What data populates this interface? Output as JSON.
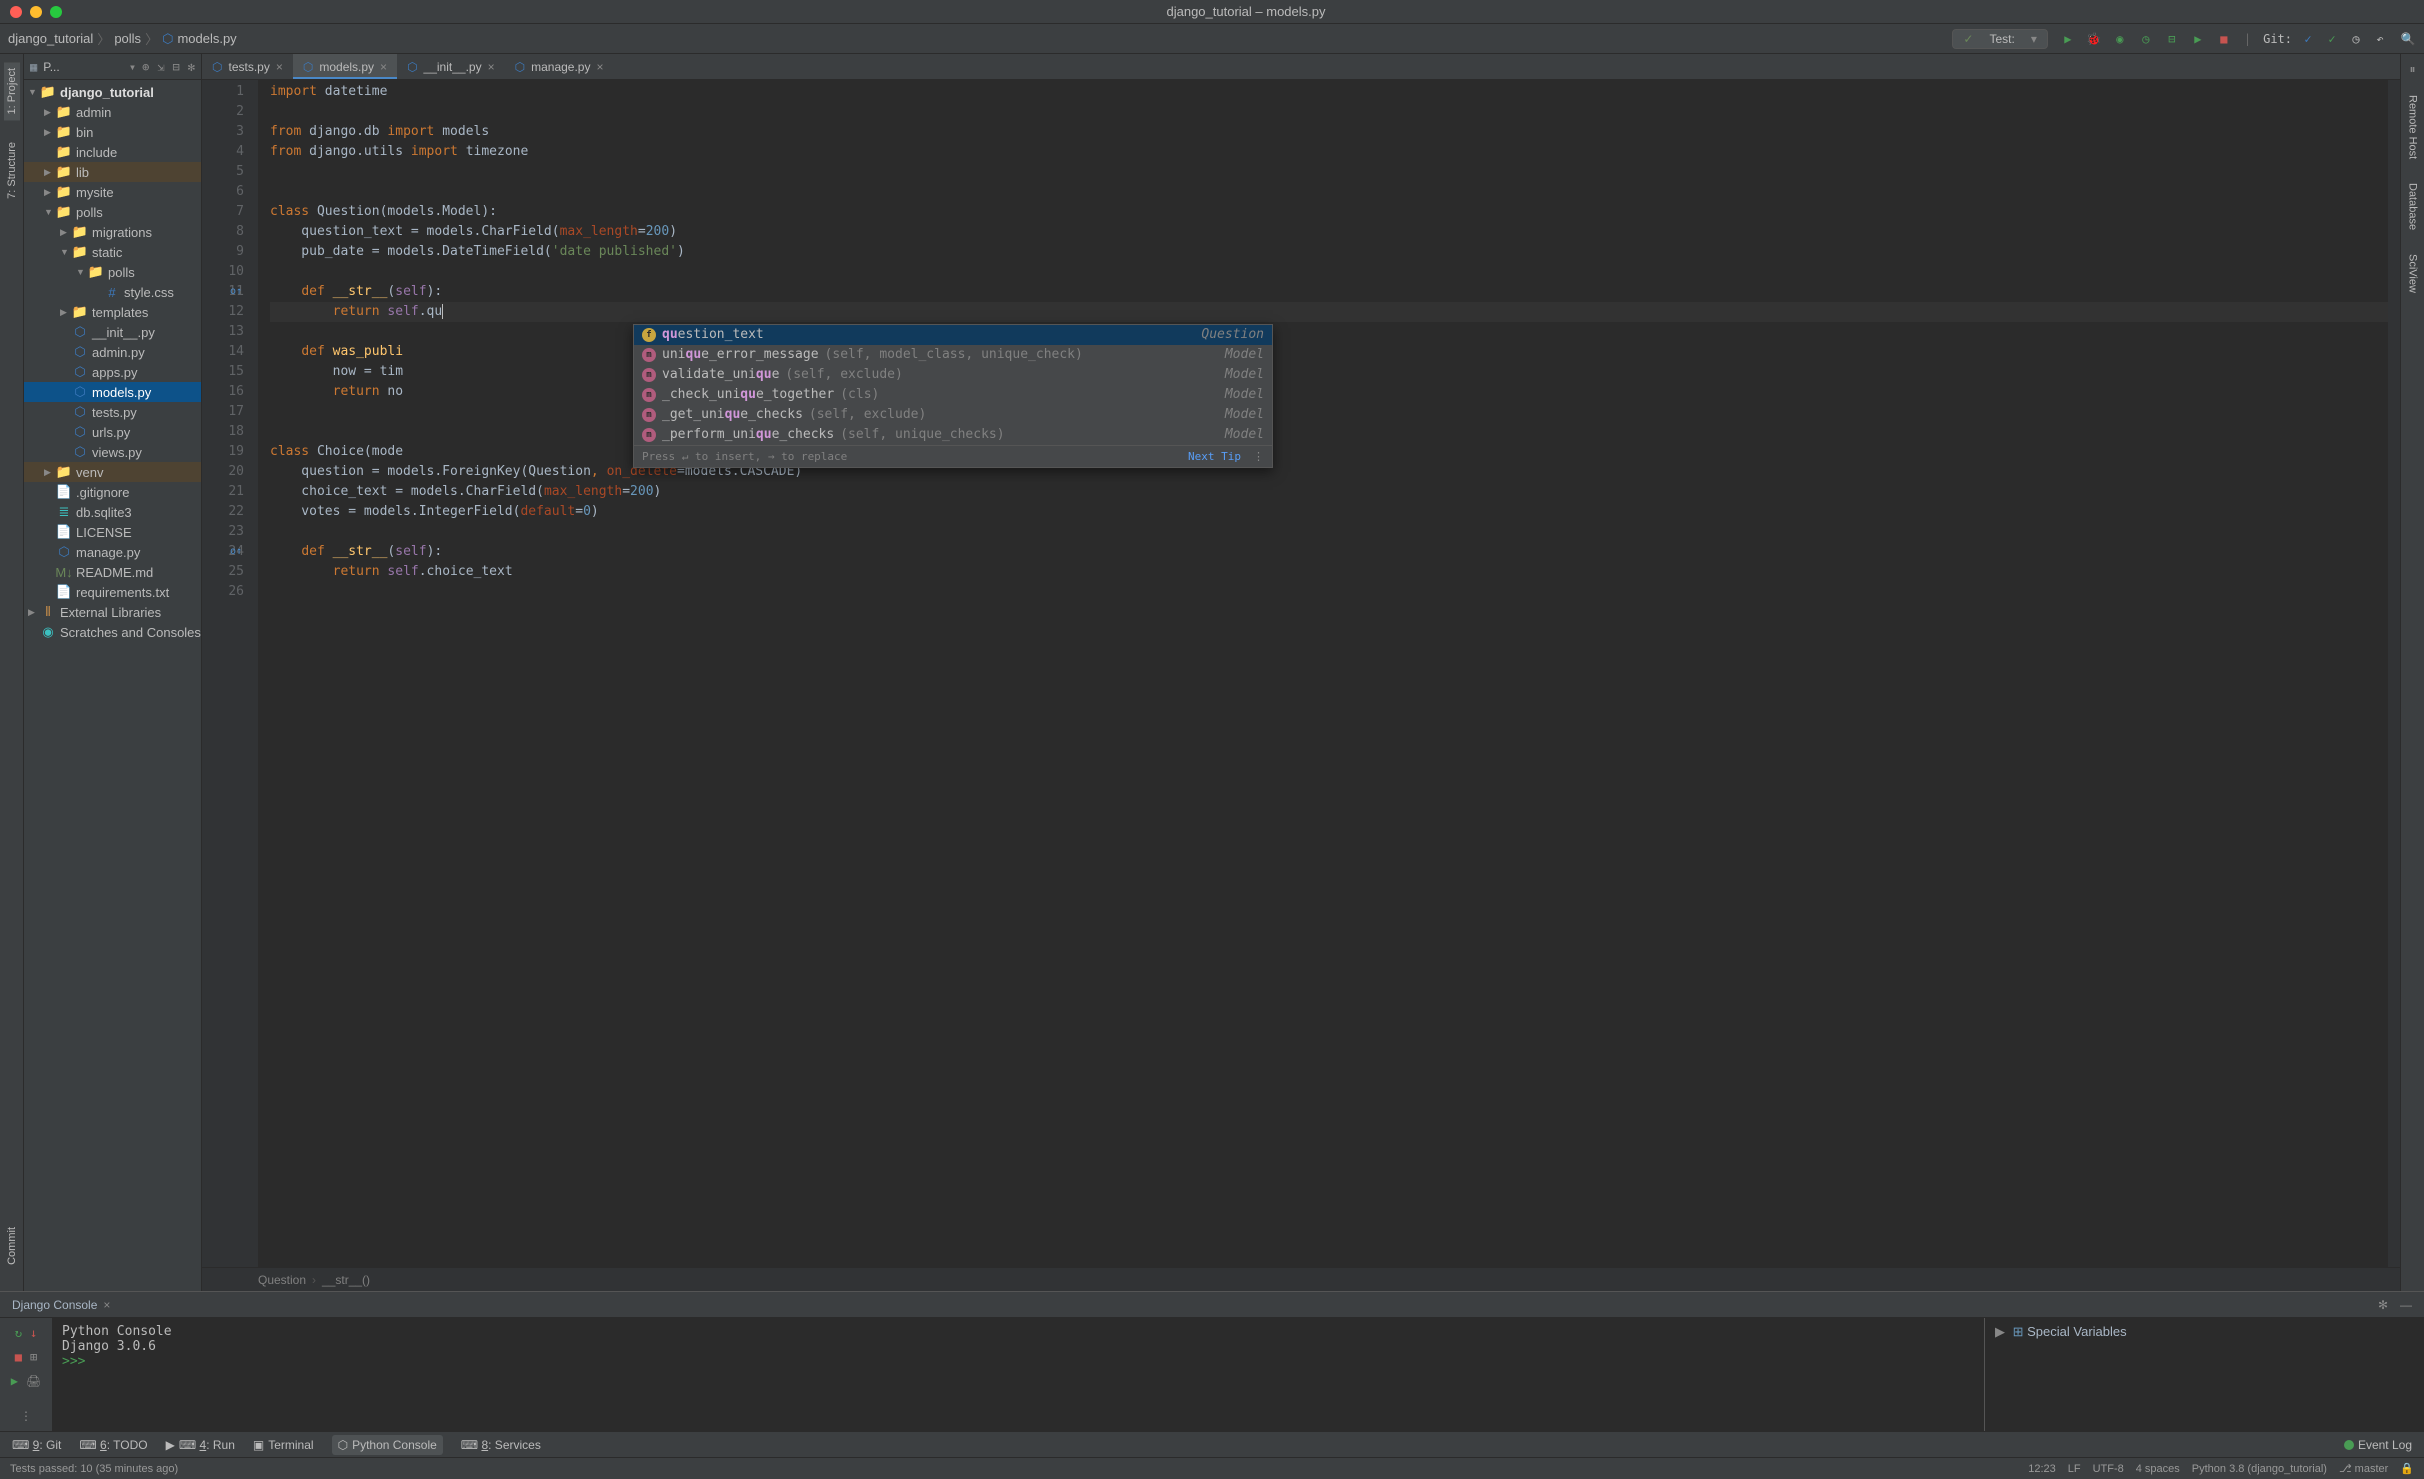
{
  "titlebar": {
    "title": "django_tutorial – models.py"
  },
  "breadcrumbs": [
    "django_tutorial",
    "polls",
    "models.py"
  ],
  "run_config": {
    "label": "Test:"
  },
  "git": {
    "label": "Git:"
  },
  "left_tabs": [
    "1: Project",
    "7: Structure",
    "Commit"
  ],
  "right_tabs": [
    "Remote Host",
    "Database",
    "SciView"
  ],
  "project": {
    "header": "P..."
  },
  "tree": [
    {
      "label": "django_tutorial",
      "depth": 0,
      "arrow": "▼",
      "icon": "folder-blue",
      "bold": true
    },
    {
      "label": "admin",
      "depth": 1,
      "arrow": "▶",
      "icon": "folder"
    },
    {
      "label": "bin",
      "depth": 1,
      "arrow": "▶",
      "icon": "folder"
    },
    {
      "label": "include",
      "depth": 1,
      "arrow": "",
      "icon": "folder"
    },
    {
      "label": "lib",
      "depth": 1,
      "arrow": "▶",
      "icon": "folder-orange",
      "highlighted": true
    },
    {
      "label": "mysite",
      "depth": 1,
      "arrow": "▶",
      "icon": "folder"
    },
    {
      "label": "polls",
      "depth": 1,
      "arrow": "▼",
      "icon": "folder"
    },
    {
      "label": "migrations",
      "depth": 2,
      "arrow": "▶",
      "icon": "folder"
    },
    {
      "label": "static",
      "depth": 2,
      "arrow": "▼",
      "icon": "folder"
    },
    {
      "label": "polls",
      "depth": 3,
      "arrow": "▼",
      "icon": "folder"
    },
    {
      "label": "style.css",
      "depth": 4,
      "arrow": "",
      "icon": "css"
    },
    {
      "label": "templates",
      "depth": 2,
      "arrow": "▶",
      "icon": "folder-purple"
    },
    {
      "label": "__init__.py",
      "depth": 2,
      "arrow": "",
      "icon": "py"
    },
    {
      "label": "admin.py",
      "depth": 2,
      "arrow": "",
      "icon": "py"
    },
    {
      "label": "apps.py",
      "depth": 2,
      "arrow": "",
      "icon": "py"
    },
    {
      "label": "models.py",
      "depth": 2,
      "arrow": "",
      "icon": "py",
      "selected": true
    },
    {
      "label": "tests.py",
      "depth": 2,
      "arrow": "",
      "icon": "py"
    },
    {
      "label": "urls.py",
      "depth": 2,
      "arrow": "",
      "icon": "py"
    },
    {
      "label": "views.py",
      "depth": 2,
      "arrow": "",
      "icon": "py"
    },
    {
      "label": "venv",
      "depth": 1,
      "arrow": "▶",
      "icon": "folder-orange",
      "highlighted": true
    },
    {
      "label": ".gitignore",
      "depth": 1,
      "arrow": "",
      "icon": "txt"
    },
    {
      "label": "db.sqlite3",
      "depth": 1,
      "arrow": "",
      "icon": "db"
    },
    {
      "label": "LICENSE",
      "depth": 1,
      "arrow": "",
      "icon": "txt"
    },
    {
      "label": "manage.py",
      "depth": 1,
      "arrow": "",
      "icon": "py"
    },
    {
      "label": "README.md",
      "depth": 1,
      "arrow": "",
      "icon": "md"
    },
    {
      "label": "requirements.txt",
      "depth": 1,
      "arrow": "",
      "icon": "txt"
    },
    {
      "label": "External Libraries",
      "depth": 0,
      "arrow": "▶",
      "icon": "lib"
    },
    {
      "label": "Scratches and Consoles",
      "depth": 0,
      "arrow": "",
      "icon": "scratch"
    }
  ],
  "editor_tabs": [
    {
      "label": "tests.py",
      "active": false
    },
    {
      "label": "models.py",
      "active": true
    },
    {
      "label": "__init__.py",
      "active": false
    },
    {
      "label": "manage.py",
      "active": false
    }
  ],
  "code_lines": [
    {
      "n": 1,
      "tokens": [
        [
          "k-orange",
          "import "
        ],
        [
          "k-white",
          "datetime"
        ]
      ]
    },
    {
      "n": 2,
      "tokens": []
    },
    {
      "n": 3,
      "tokens": [
        [
          "k-orange",
          "from "
        ],
        [
          "k-white",
          "django.db "
        ],
        [
          "k-orange",
          "import "
        ],
        [
          "k-white",
          "models"
        ]
      ]
    },
    {
      "n": 4,
      "tokens": [
        [
          "k-orange",
          "from "
        ],
        [
          "k-white",
          "django.utils "
        ],
        [
          "k-orange",
          "import "
        ],
        [
          "k-white",
          "timezone"
        ]
      ]
    },
    {
      "n": 5,
      "tokens": []
    },
    {
      "n": 6,
      "tokens": []
    },
    {
      "n": 7,
      "tokens": [
        [
          "k-orange",
          "class "
        ],
        [
          "k-white",
          "Question(models.Model):"
        ]
      ]
    },
    {
      "n": 8,
      "tokens": [
        [
          "k-white",
          "    question_text = models.CharField("
        ],
        [
          "k-param",
          "max_length"
        ],
        [
          "k-white",
          "="
        ],
        [
          "k-blue",
          "200"
        ],
        [
          "k-white",
          ")"
        ]
      ]
    },
    {
      "n": 9,
      "tokens": [
        [
          "k-white",
          "    pub_date = models.DateTimeField("
        ],
        [
          "k-green",
          "'date published'"
        ],
        [
          "k-white",
          ")"
        ]
      ]
    },
    {
      "n": 10,
      "tokens": []
    },
    {
      "n": 11,
      "tokens": [
        [
          "k-white",
          "    "
        ],
        [
          "k-orange",
          "def "
        ],
        [
          "k-yellow",
          "__str__"
        ],
        [
          "k-white",
          "("
        ],
        [
          "k-purple",
          "self"
        ],
        [
          "k-white",
          "):"
        ]
      ],
      "override": true
    },
    {
      "n": 12,
      "tokens": [
        [
          "k-white",
          "        "
        ],
        [
          "k-orange",
          "return "
        ],
        [
          "k-purple",
          "self"
        ],
        [
          "k-white",
          ".qu"
        ]
      ],
      "current": true,
      "caret": true
    },
    {
      "n": 13,
      "tokens": []
    },
    {
      "n": 14,
      "tokens": [
        [
          "k-white",
          "    "
        ],
        [
          "k-orange",
          "def "
        ],
        [
          "k-yellow",
          "was_publi"
        ]
      ]
    },
    {
      "n": 15,
      "tokens": [
        [
          "k-white",
          "        now = tim"
        ]
      ]
    },
    {
      "n": 16,
      "tokens": [
        [
          "k-white",
          "        "
        ],
        [
          "k-orange",
          "return "
        ],
        [
          "k-white",
          "no"
        ]
      ]
    },
    {
      "n": 17,
      "tokens": []
    },
    {
      "n": 18,
      "tokens": []
    },
    {
      "n": 19,
      "tokens": [
        [
          "k-orange",
          "class "
        ],
        [
          "k-white",
          "Choice(mode"
        ]
      ]
    },
    {
      "n": 20,
      "tokens": [
        [
          "k-white",
          "    question = models.ForeignKey(Question"
        ],
        [
          "k-orange",
          ", "
        ],
        [
          "k-param",
          "on_delete"
        ],
        [
          "k-white",
          "=models.CASCADE)"
        ]
      ]
    },
    {
      "n": 21,
      "tokens": [
        [
          "k-white",
          "    choice_text = models.CharField("
        ],
        [
          "k-param",
          "max_length"
        ],
        [
          "k-white",
          "="
        ],
        [
          "k-blue",
          "200"
        ],
        [
          "k-white",
          ")"
        ]
      ]
    },
    {
      "n": 22,
      "tokens": [
        [
          "k-white",
          "    votes = models.IntegerField("
        ],
        [
          "k-param",
          "default"
        ],
        [
          "k-white",
          "="
        ],
        [
          "k-blue",
          "0"
        ],
        [
          "k-white",
          ")"
        ]
      ]
    },
    {
      "n": 23,
      "tokens": []
    },
    {
      "n": 24,
      "tokens": [
        [
          "k-white",
          "    "
        ],
        [
          "k-orange",
          "def "
        ],
        [
          "k-yellow",
          "__str__"
        ],
        [
          "k-white",
          "("
        ],
        [
          "k-purple",
          "self"
        ],
        [
          "k-white",
          "):"
        ]
      ],
      "override": true
    },
    {
      "n": 25,
      "tokens": [
        [
          "k-white",
          "        "
        ],
        [
          "k-orange",
          "return "
        ],
        [
          "k-purple",
          "self"
        ],
        [
          "k-white",
          ".choice_text"
        ]
      ]
    },
    {
      "n": 26,
      "tokens": []
    }
  ],
  "autocomplete": {
    "rows": [
      {
        "icon": "f",
        "prefix": "qu",
        "name": "estion_text",
        "args": "",
        "type": "Question",
        "selected": true
      },
      {
        "icon": "m",
        "prefix": "uniqu",
        "name": "e_error_message",
        "args": "(self, model_class, unique_check)",
        "type": "Model"
      },
      {
        "icon": "m",
        "prefix": "validate_uniqu",
        "name": "e",
        "args": "(self, exclude)",
        "type": "Model"
      },
      {
        "icon": "m",
        "prefix": "_check_uniqu",
        "name": "e_together",
        "args": "(cls)",
        "type": "Model"
      },
      {
        "icon": "m",
        "prefix": "_get_uniqu",
        "name": "e_checks",
        "args": "(self, exclude)",
        "type": "Model"
      },
      {
        "icon": "m",
        "prefix": "_perform_uniqu",
        "name": "e_checks",
        "args": "(self, unique_checks)",
        "type": "Model"
      }
    ],
    "footer_left": "Press ↵ to insert, → to replace",
    "footer_tip": "Next Tip"
  },
  "editor_crumbs": [
    "Question",
    "__str__()"
  ],
  "console": {
    "tab": "Django Console",
    "lines": [
      "Python Console",
      "Django 3.0.6",
      "",
      ">>> "
    ],
    "vars_label": "Special Variables"
  },
  "tool_windows": {
    "left": [
      {
        "label": "9: Git",
        "u": "9"
      },
      {
        "label": "6: TODO",
        "u": "6"
      },
      {
        "label": "4: Run",
        "u": "4",
        "icon": "play"
      },
      {
        "label": "Terminal",
        "icon": "term"
      },
      {
        "label": "Python Console",
        "icon": "py",
        "active": true
      },
      {
        "label": "8: Services",
        "u": "8"
      }
    ],
    "event_log": "Event Log"
  },
  "statusbar": {
    "left": "Tests passed: 10 (35 minutes ago)",
    "right": [
      "12:23",
      "LF",
      "UTF-8",
      "4 spaces",
      "Python 3.8 (django_tutorial)",
      "master"
    ]
  }
}
